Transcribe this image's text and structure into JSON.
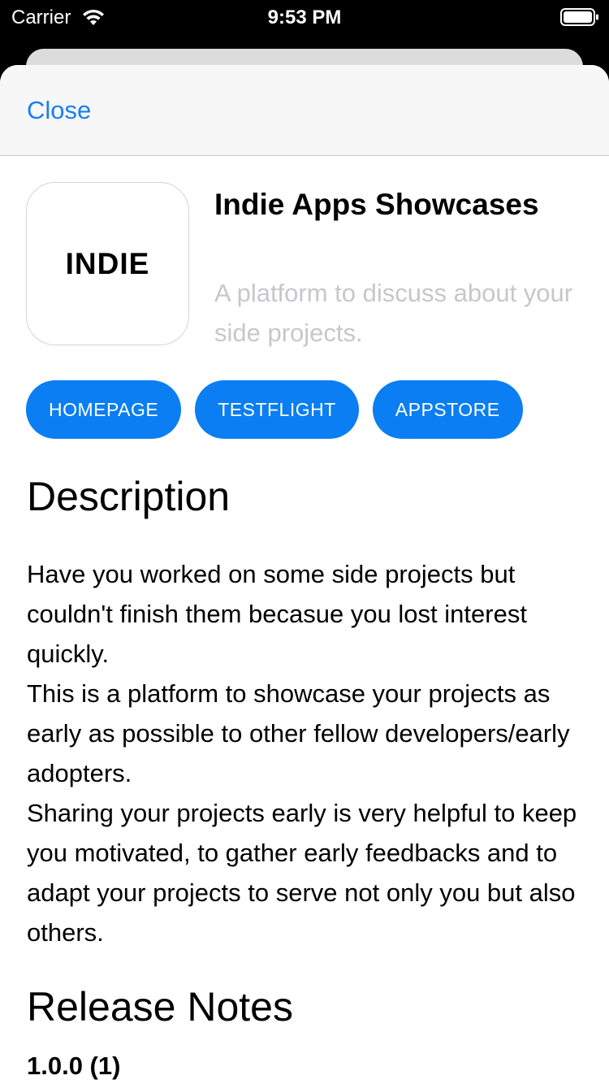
{
  "status_bar": {
    "carrier": "Carrier",
    "time": "9:53 PM"
  },
  "nav": {
    "close_label": "Close"
  },
  "app": {
    "icon_text": "INDIE",
    "title": "Indie Apps Showcases",
    "subtitle": "A platform to discuss about your side projects."
  },
  "links": [
    "HOMEPAGE",
    "TESTFLIGHT",
    "APPSTORE"
  ],
  "description": {
    "heading": "Description",
    "body": "Have you worked on some side projects but couldn't finish them becasue you lost interest quickly.\nThis is a platform to showcase your projects as early as possible to other fellow developers/early adopters.\nSharing your projects early is very helpful to keep you motivated, to gather early feedbacks and to adapt your projects to serve not only you but also others."
  },
  "release_notes": {
    "heading": "Release Notes",
    "version": "1.0.0 (1)"
  },
  "colors": {
    "accent": "#0a7ef2",
    "link_text": "#1a7ff2",
    "subtitle": "#c7c7cc"
  }
}
